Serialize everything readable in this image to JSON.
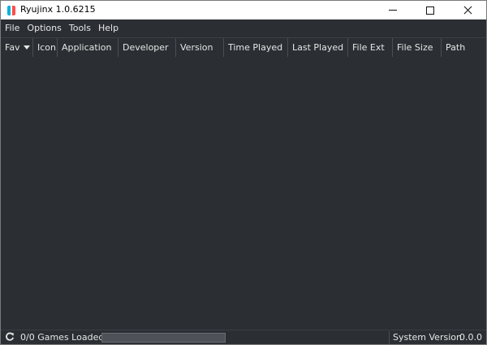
{
  "window": {
    "title": "Ryujinx 1.0.6215",
    "logo_colors": {
      "left": "#00b4d8",
      "right": "#ff4d4d"
    },
    "controls": [
      "minimize-icon",
      "maximize-icon",
      "close-icon"
    ]
  },
  "menu": {
    "items": [
      {
        "label": "File"
      },
      {
        "label": "Options"
      },
      {
        "label": "Tools"
      },
      {
        "label": "Help"
      }
    ]
  },
  "table": {
    "columns": [
      {
        "label": "Fav",
        "sorted": true,
        "sort_icon": "sort-down-icon"
      },
      {
        "label": "Icon"
      },
      {
        "label": "Application"
      },
      {
        "label": "Developer"
      },
      {
        "label": "Version"
      },
      {
        "label": "Time Played"
      },
      {
        "label": "Last Played"
      },
      {
        "label": "File Ext"
      },
      {
        "label": "File Size"
      },
      {
        "label": "Path"
      }
    ],
    "rows": []
  },
  "status": {
    "refresh_icon": "refresh-icon",
    "games_loaded": "0/0 Games Loaded",
    "progress": 0,
    "system_version_label": "System Version",
    "system_version_value": "0.0.0"
  }
}
